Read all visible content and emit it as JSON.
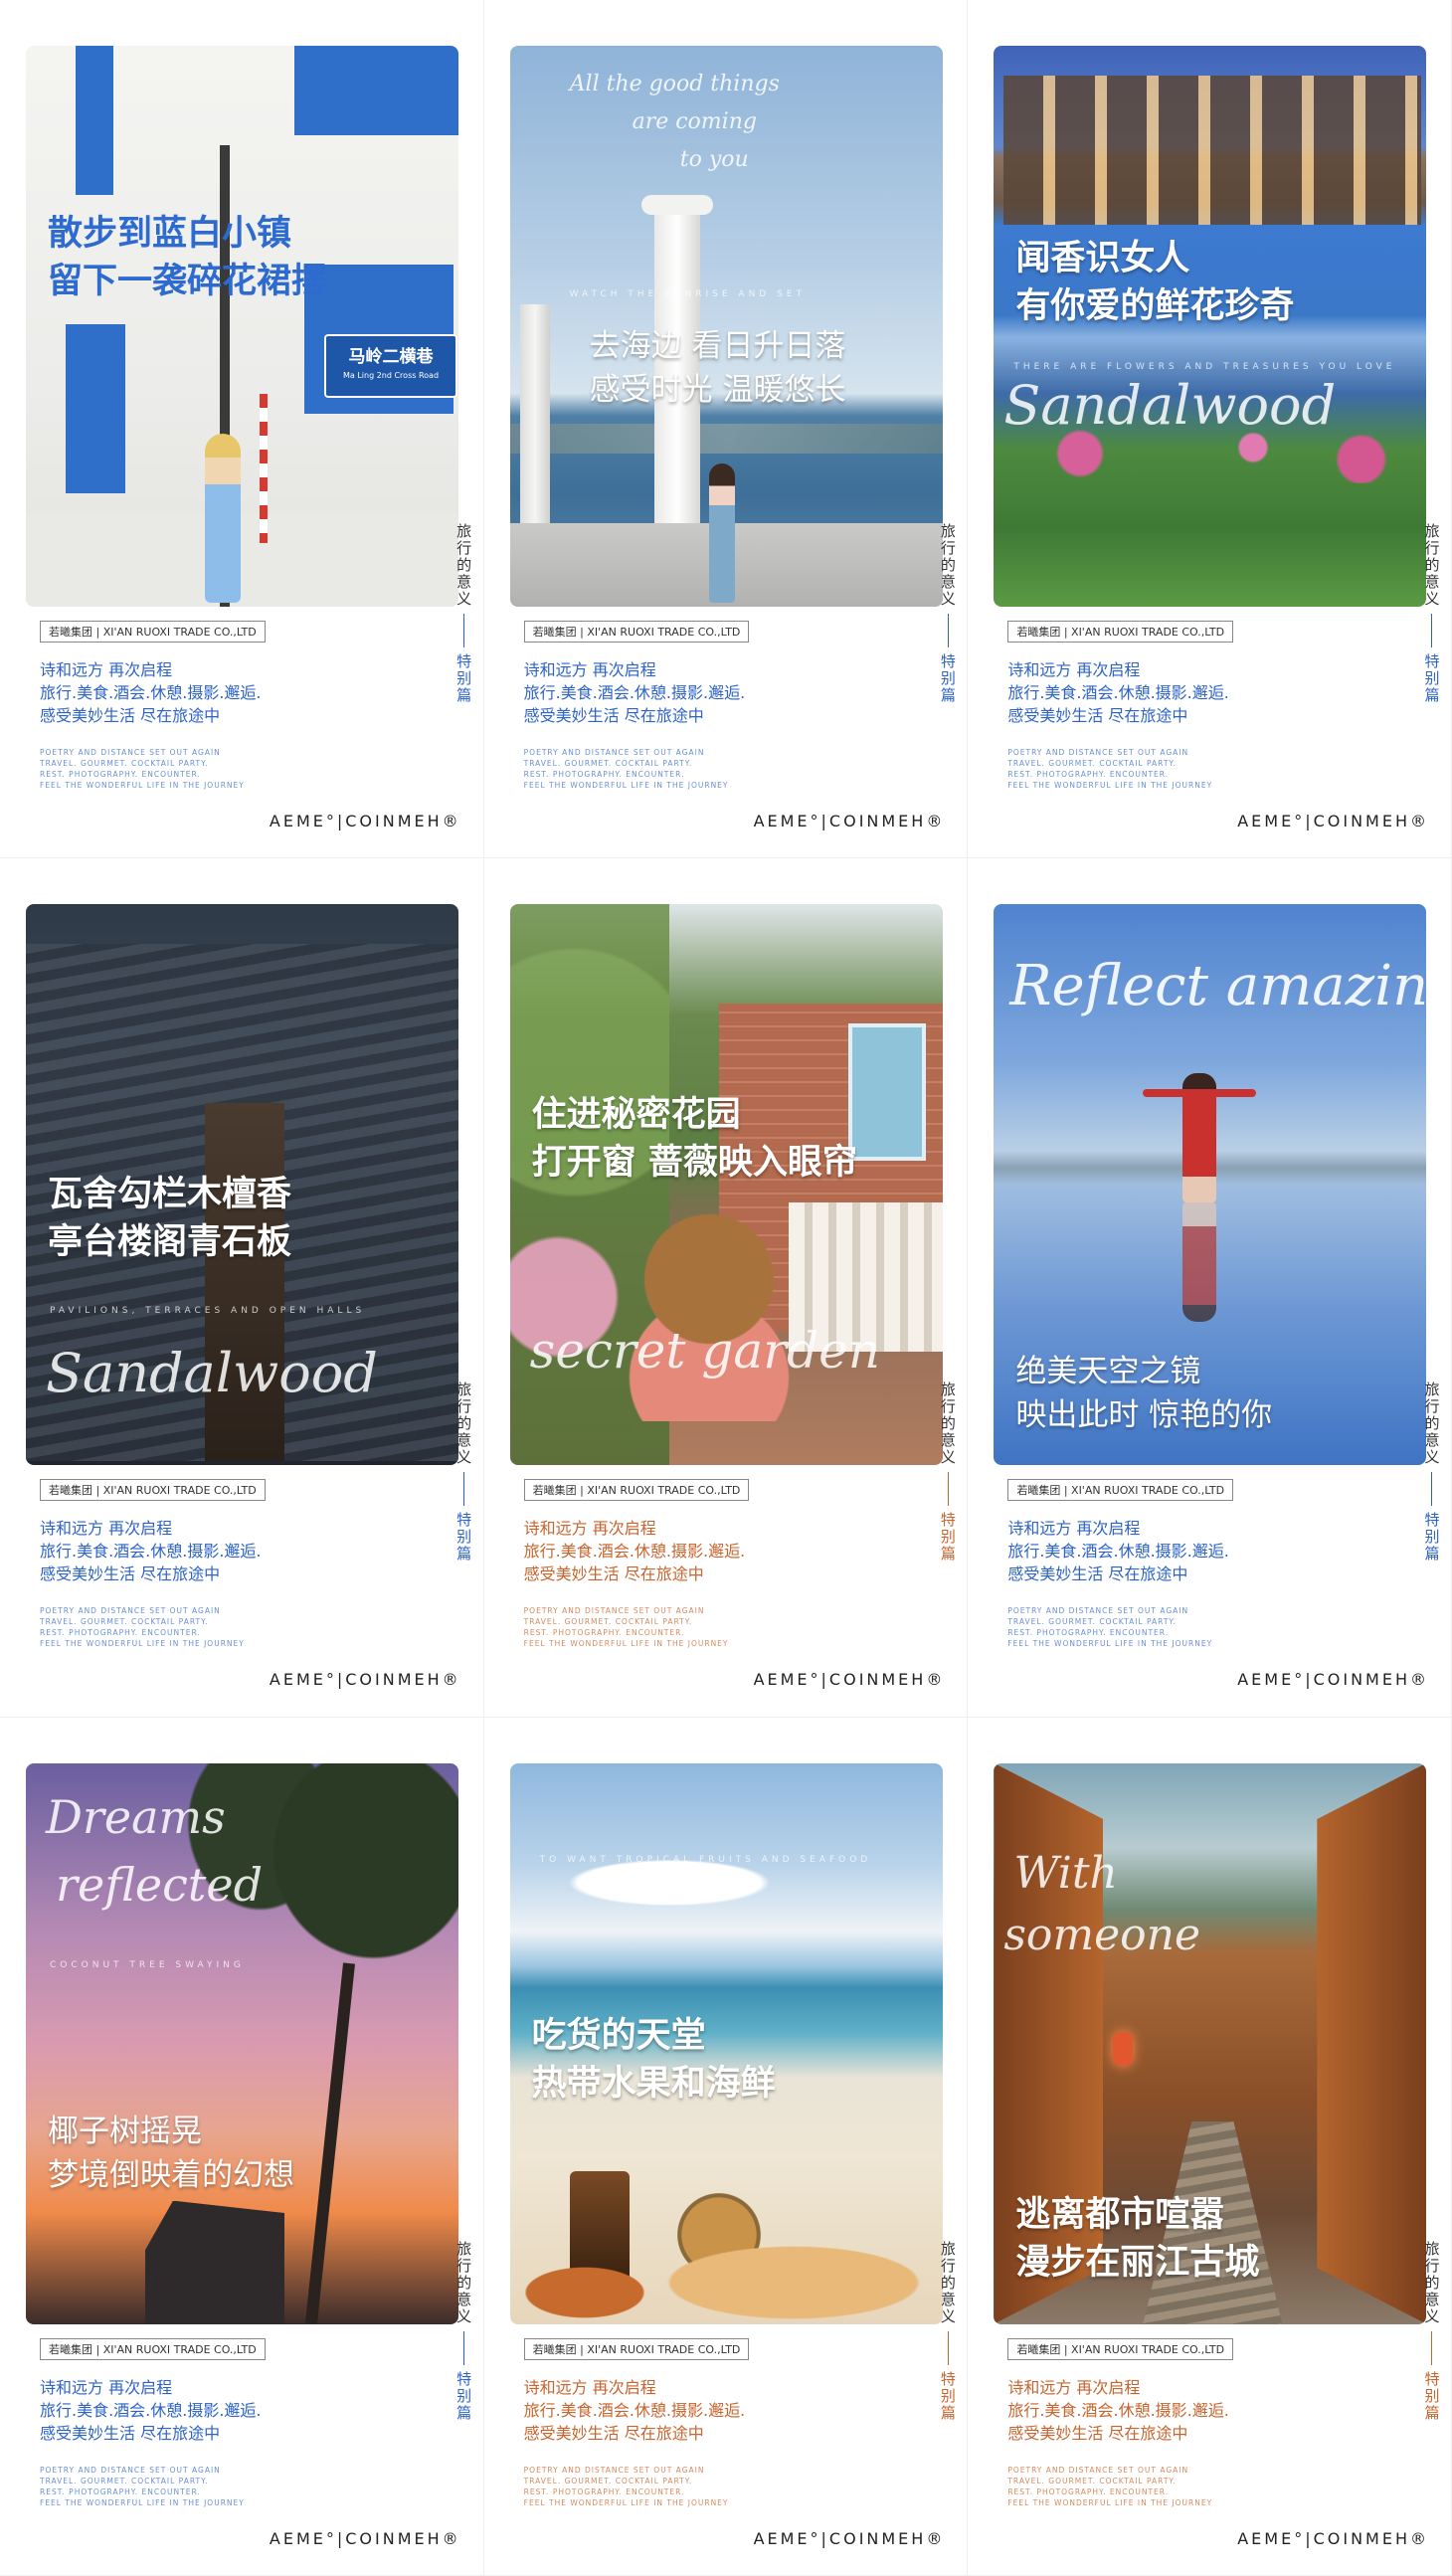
{
  "common": {
    "company": "若曦集团 | XI'AN RUOXI TRADE CO.,LTD",
    "desc": [
      "诗和远方 再次启程",
      "旅行.美食.酒会.休憩.摄影.邂逅.",
      "感受美妙生活 尽在旅途中"
    ],
    "eng": [
      "POETRY AND DISTANCE SET OUT AGAIN",
      "TRAVEL. GOURMET. COCKTAIL PARTY.",
      "REST. PHOTOGRAPHY. ENCOUNTER.",
      "FEEL THE WONDERFUL LIFE IN THE JOURNEY"
    ],
    "side_top": "旅行的意义",
    "side_bottom": "特别篇",
    "brand": "AEME°|COINMEH®"
  },
  "cards": [
    {
      "headline": [
        "散步到蓝白小镇",
        "留下一袭碎花裙摆"
      ],
      "street_sign": "马岭二横巷",
      "street_sign_en": "Ma Ling 2nd Cross Road"
    },
    {
      "script": [
        "All the good things",
        "are coming",
        "to you"
      ],
      "tiny": "WATCH THE SUNRISE AND SET",
      "headline": [
        "去海边 看日升日落",
        "感受时光 温暖悠长"
      ]
    },
    {
      "headline": [
        "闻香识女人",
        "有你爱的鲜花珍奇"
      ],
      "tiny": "THERE ARE FLOWERS AND TREASURES YOU LOVE",
      "script": [
        "Sandalwood"
      ]
    },
    {
      "headline": [
        "瓦舍勾栏木檀香",
        "亭台楼阁青石板"
      ],
      "tiny": "PAVILIONS, TERRACES AND OPEN HALLS",
      "script": [
        "Sandalwood"
      ]
    },
    {
      "headline": [
        "住进秘密花园",
        "打开窗 蔷薇映入眼帘"
      ],
      "script": [
        "secret garden"
      ]
    },
    {
      "script": [
        "Reflect amazing"
      ],
      "headline": [
        "绝美天空之镜",
        "映出此时 惊艳的你"
      ]
    },
    {
      "script": [
        "Dreams",
        "reflected"
      ],
      "tiny": "COCONUT TREE SWAYING",
      "headline": [
        "椰子树摇晃",
        "梦境倒映着的幻想"
      ]
    },
    {
      "tiny": "TO WANT TROPICAL FRUITS AND SEAFOOD",
      "headline": [
        "吃货的天堂",
        "热带水果和海鲜"
      ]
    },
    {
      "script": [
        "With",
        "someone"
      ],
      "headline": [
        "逃离都市喧嚣",
        "漫步在丽江古城"
      ]
    }
  ],
  "colors": {
    "accent_blue": "#2d63c8",
    "accent_orange": "#c8642e",
    "brand_text": "#222222"
  }
}
